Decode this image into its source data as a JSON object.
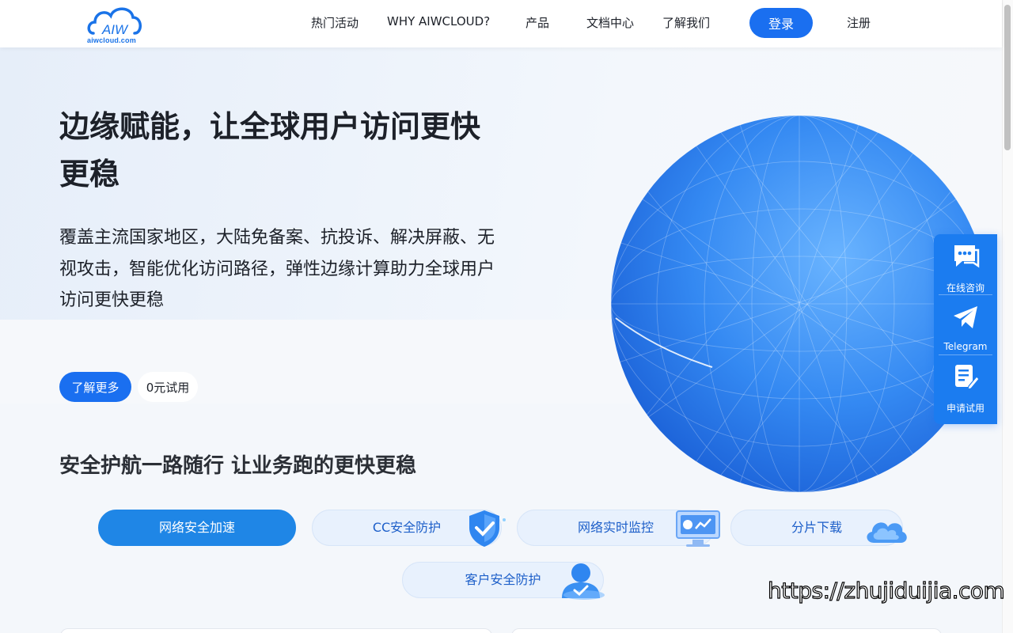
{
  "header": {
    "logo_text": "aiwcloud.com",
    "logo_mark": "AIW",
    "nav": [
      {
        "label": "热门活动"
      },
      {
        "label": "WHY AIWCLOUD?"
      },
      {
        "label": "产品"
      },
      {
        "label": "文档中心"
      },
      {
        "label": "了解我们"
      }
    ],
    "login_label": "登录",
    "register_label": "注册"
  },
  "hero": {
    "title": "边缘赋能，让全球用户访问更快更稳",
    "description": "覆盖主流国家地区，大陆免备案、抗投诉、解决屏蔽、无视攻击，智能优化访问路径，弹性边缘计算助力全球用户访问更快更稳",
    "learn_more_label": "了解更多",
    "trial_label": "0元试用"
  },
  "section": {
    "title": "安全护航一路随行 让业务跑的更快更稳",
    "features": [
      {
        "label": "网络安全加速",
        "active": true,
        "icon": "none"
      },
      {
        "label": "CC安全防护",
        "active": false,
        "icon": "shield-check-icon"
      },
      {
        "label": "网络实时监控",
        "active": false,
        "icon": "monitor-chart-icon"
      },
      {
        "label": "分片下载",
        "active": false,
        "icon": "cloud-icon"
      },
      {
        "label": "客户安全防护",
        "active": false,
        "icon": "user-shield-icon"
      }
    ]
  },
  "float_panel": {
    "items": [
      {
        "label": "在线咨询",
        "icon": "chat-icon"
      },
      {
        "label": "Telegram",
        "icon": "telegram-icon"
      },
      {
        "label": "申请试用",
        "icon": "form-edit-icon"
      }
    ]
  },
  "watermark": "https://zhujiduijia.com",
  "colors": {
    "primary": "#1a6ff0",
    "pill_active": "#1f86e6",
    "pill_bg": "#e8f1fd",
    "globe": "#2f86f0"
  }
}
